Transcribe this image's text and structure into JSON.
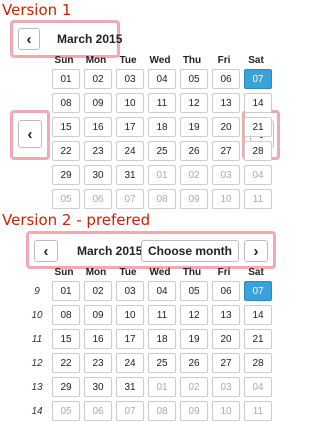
{
  "version1": {
    "label": "Version 1",
    "nav": {
      "prev": "‹",
      "next": "›",
      "title": "March 2015"
    },
    "weekdays": [
      "Sun",
      "Mon",
      "Tue",
      "Wed",
      "Thu",
      "Fri",
      "Sat"
    ],
    "weeks": [
      [
        "01",
        "02",
        "03",
        "04",
        "05",
        "06",
        "07"
      ],
      [
        "08",
        "09",
        "10",
        "11",
        "12",
        "13",
        "14"
      ],
      [
        "15",
        "16",
        "17",
        "18",
        "19",
        "20",
        "21"
      ],
      [
        "22",
        "23",
        "24",
        "25",
        "26",
        "27",
        "28"
      ],
      [
        "29",
        "30",
        "31",
        "01",
        "02",
        "03",
        "04"
      ],
      [
        "05",
        "06",
        "07",
        "08",
        "09",
        "10",
        "11"
      ]
    ]
  },
  "version2": {
    "label": "Version 2 - prefered",
    "nav": {
      "prev": "‹",
      "next": "›",
      "title": "March 2015",
      "choose": "Choose month"
    },
    "weekdays": [
      "Sun",
      "Mon",
      "Tue",
      "Wed",
      "Thu",
      "Fri",
      "Sat"
    ],
    "week_numbers": [
      "9",
      "10",
      "11",
      "12",
      "13",
      "14"
    ],
    "weeks": [
      [
        "01",
        "02",
        "03",
        "04",
        "05",
        "06",
        "07"
      ],
      [
        "08",
        "09",
        "10",
        "11",
        "12",
        "13",
        "14"
      ],
      [
        "15",
        "16",
        "17",
        "18",
        "19",
        "20",
        "21"
      ],
      [
        "22",
        "23",
        "24",
        "25",
        "26",
        "27",
        "28"
      ],
      [
        "29",
        "30",
        "31",
        "01",
        "02",
        "03",
        "04"
      ],
      [
        "05",
        "06",
        "07",
        "08",
        "09",
        "10",
        "11"
      ]
    ]
  },
  "selected_day": "07",
  "colors": {
    "label": "#cc2200",
    "highlight": "#f3a7b0",
    "selected": "#3aa2d8"
  }
}
